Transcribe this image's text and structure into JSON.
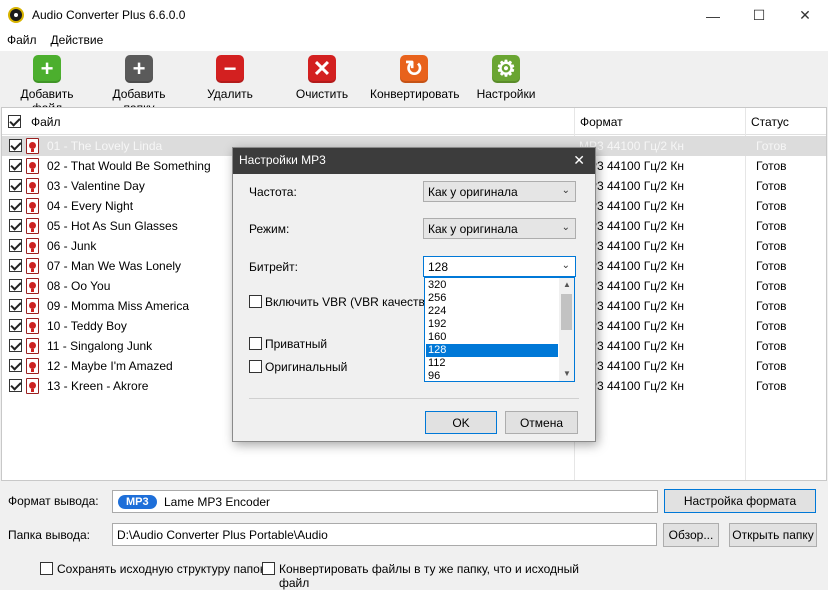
{
  "window": {
    "title": "Audio Converter Plus 6.6.0.0",
    "controls": {
      "minimize": "—",
      "maximize": "☐",
      "close": "✕"
    }
  },
  "menu": [
    "Файл",
    "Действие"
  ],
  "toolbar": [
    {
      "label": "Добавить файл",
      "icon": "add-file-icon",
      "color": "#4caf2e",
      "glyph": "+"
    },
    {
      "label": "Добавить папку",
      "icon": "add-folder-icon",
      "color": "#5a5a5a",
      "glyph": "+"
    },
    {
      "label": "Удалить",
      "icon": "remove-icon",
      "color": "#d32020",
      "glyph": "−"
    },
    {
      "label": "Очистить",
      "icon": "clear-icon",
      "color": "#d32020",
      "glyph": "✕"
    },
    {
      "label": "Конвертировать",
      "icon": "convert-icon",
      "color": "#e8621c",
      "glyph": "↻"
    },
    {
      "label": "Настройки",
      "icon": "settings-icon",
      "color": "#6aa532",
      "glyph": "⚙"
    }
  ],
  "file_list": {
    "headers": {
      "file": "Файл",
      "format": "Формат",
      "status": "Статус"
    },
    "rows": [
      {
        "name": "01 - The Lovely Linda",
        "format": "MP3 44100 Гц/2 Кн",
        "status": "Готов",
        "selected": true
      },
      {
        "name": "02 - That Would Be Something",
        "format": "MP3 44100 Гц/2 Кн",
        "status": "Готов"
      },
      {
        "name": "03 - Valentine Day",
        "format": "MP3 44100 Гц/2 Кн",
        "status": "Готов"
      },
      {
        "name": "04 - Every Night",
        "format": "MP3 44100 Гц/2 Кн",
        "status": "Готов"
      },
      {
        "name": "05 - Hot As Sun Glasses",
        "format": "MP3 44100 Гц/2 Кн",
        "status": "Готов"
      },
      {
        "name": "06 - Junk",
        "format": "MP3 44100 Гц/2 Кн",
        "status": "Готов"
      },
      {
        "name": "07 - Man We Was Lonely",
        "format": "MP3 44100 Гц/2 Кн",
        "status": "Готов"
      },
      {
        "name": "08 - Oo You",
        "format": "MP3 44100 Гц/2 Кн",
        "status": "Готов"
      },
      {
        "name": "09 - Momma Miss America",
        "format": "MP3 44100 Гц/2 Кн",
        "status": "Готов"
      },
      {
        "name": "10 - Teddy Boy",
        "format": "MP3 44100 Гц/2 Кн",
        "status": "Готов"
      },
      {
        "name": "11 - Singalong Junk",
        "format": "MP3 44100 Гц/2 Кн",
        "status": "Готов"
      },
      {
        "name": "12 - Maybe I'm Amazed",
        "format": "MP3 44100 Гц/2 Кн",
        "status": "Готов"
      },
      {
        "name": "13 - Kreen - Akrore",
        "format": "MP3 44100 Гц/2 Кн",
        "status": "Готов"
      }
    ]
  },
  "output": {
    "format_label": "Формат вывода:",
    "format_badge": "MP3",
    "format_value": "Lame MP3 Encoder",
    "format_settings_button": "Настройка формата",
    "folder_label": "Папка вывода:",
    "folder_value": "D:\\Audio Converter Plus Portable\\Audio",
    "browse_button": "Обзор...",
    "open_folder_button": "Открыть папку",
    "keep_structure": "Сохранять исходную структуру папок",
    "same_folder": "Конвертировать файлы в ту же папку, что и исходный файл"
  },
  "dialog": {
    "title": "Настройки MP3",
    "close": "✕",
    "frequency_label": "Частота:",
    "frequency_value": "Как у оригинала",
    "mode_label": "Режим:",
    "mode_value": "Как у оригинала",
    "bitrate_label": "Битрейт:",
    "bitrate_value": "128",
    "vbr_label": "Включить VBR (VBR качество:)",
    "private_label": "Приватный",
    "original_label": "Оригинальный",
    "bitrate_options": [
      "320",
      "256",
      "224",
      "192",
      "160",
      "128",
      "112",
      "96"
    ],
    "bitrate_selected_index": 5,
    "ok_button": "OK",
    "cancel_button": "Отмена"
  }
}
